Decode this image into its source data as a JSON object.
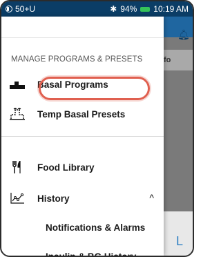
{
  "status_bar": {
    "pod_status": "50+U",
    "battery_percent": "94%",
    "time": "10:19 AM"
  },
  "backdrop": {
    "tab_partial_text": "fo",
    "bottom_partial_text": "L"
  },
  "menu": {
    "section_heading": "MANAGE PROGRAMS & PRESETS",
    "items": [
      {
        "label": "Basal Programs",
        "icon": "basal-program-icon"
      },
      {
        "label": "Temp Basal Presets",
        "icon": "temp-basal-icon"
      },
      {
        "label": "Food Library",
        "icon": "fork-knife-icon"
      },
      {
        "label": "History",
        "icon": "history-chart-icon"
      }
    ],
    "history_subitems": [
      {
        "label": "Notifications & Alarms"
      },
      {
        "label": "Insulin & BG History"
      }
    ]
  },
  "colors": {
    "status_bar": "#0b3d66",
    "highlight": "#e06050",
    "battery": "#35c35a"
  }
}
